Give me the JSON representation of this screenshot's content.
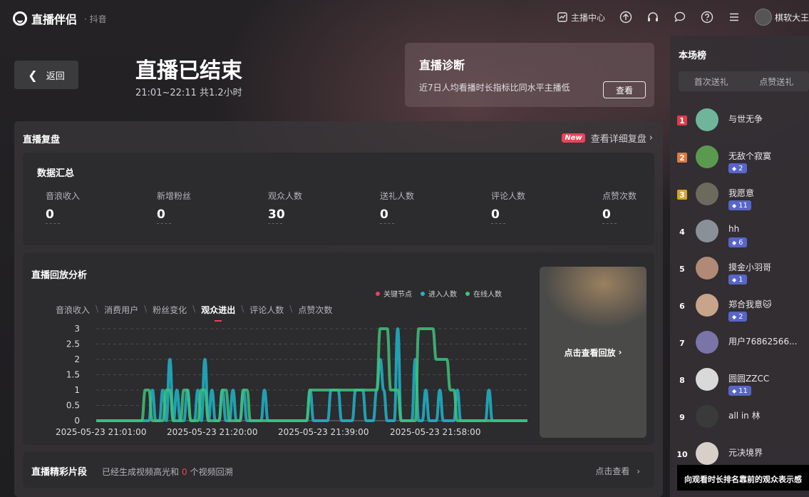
{
  "app": {
    "name": "直播伴侣",
    "platform": "· 抖音"
  },
  "topbar": {
    "anchor_center": "主播中心",
    "user_name": "棋软大王"
  },
  "header": {
    "back_label": "返回",
    "title": "直播已结束",
    "subtitle": "21:01~22:11 共1.2小时",
    "diagnosis": {
      "title": "直播诊断",
      "desc": "近7日人均看播时长指标比同水平主播低",
      "button": "查看"
    }
  },
  "review": {
    "title": "直播复盘",
    "new_badge": "New",
    "detail_link": "查看详细复盘",
    "summary": {
      "title": "数据汇总",
      "metrics": [
        {
          "label": "音浪收入",
          "value": "0"
        },
        {
          "label": "新增粉丝",
          "value": "0"
        },
        {
          "label": "观众人数",
          "value": "30"
        },
        {
          "label": "送礼人数",
          "value": "0"
        },
        {
          "label": "评论人数",
          "value": "0"
        },
        {
          "label": "点赞次数",
          "value": "0"
        }
      ]
    },
    "analysis": {
      "title": "直播回放分析",
      "tabs": [
        "音浪收入",
        "消费用户",
        "粉丝变化",
        "观众进出",
        "评论人数",
        "点赞次数"
      ],
      "active_tab": "观众进出",
      "replay_label": "点击查看回放"
    },
    "highlights": {
      "title": "直播精彩片段",
      "desc_pre": "已经生成视频高光和",
      "count": "0",
      "desc_post": "个视频回溯",
      "link": "点击查看"
    }
  },
  "chart_data": {
    "type": "line",
    "legend": [
      "关键节点",
      "进入人数",
      "在线人数"
    ],
    "colors": {
      "关键节点": "#e8445a",
      "进入人数": "#1fb5c9",
      "在线人数": "#3ec27a"
    },
    "y_ticks": [
      "3",
      "2.5",
      "2",
      "1.5",
      "1",
      "0.5",
      "0"
    ],
    "x_ticks": [
      "2025-05-23 21:01:00",
      "2025-05-23 21:20:00",
      "2025-05-23 21:39:00",
      "2025-05-23 21:58:00"
    ],
    "ylim": [
      0,
      3
    ],
    "series": [
      {
        "name": "进入人数",
        "values": [
          0,
          0,
          0,
          0,
          0,
          0,
          0,
          0,
          0,
          0,
          0,
          0,
          0,
          0,
          0,
          0,
          1,
          0,
          0,
          1,
          0,
          2,
          0,
          1,
          0,
          0,
          1,
          0,
          0,
          1,
          0,
          2,
          0,
          1,
          0,
          0,
          1,
          0,
          0,
          1,
          0,
          0,
          1,
          0,
          0,
          0,
          0,
          0,
          1,
          0,
          0,
          0,
          0,
          0,
          0,
          0,
          0,
          0,
          0,
          0,
          0,
          1,
          0,
          0,
          0,
          0,
          0,
          1,
          1,
          1,
          0,
          0,
          0,
          0,
          1,
          1,
          1,
          0,
          0,
          0,
          1,
          2,
          1,
          0,
          0,
          0,
          3,
          0,
          0,
          0,
          0,
          2,
          0,
          0,
          1,
          0,
          0,
          0,
          1,
          0,
          0,
          0,
          0,
          1,
          0,
          0,
          0,
          0,
          0,
          0,
          0,
          0,
          1,
          0,
          0,
          0,
          0,
          0,
          0,
          0,
          0,
          0,
          0,
          0
        ]
      },
      {
        "name": "在线人数",
        "values": [
          0,
          0,
          0,
          0,
          0,
          0,
          0,
          0,
          0,
          0,
          0,
          0,
          0,
          0,
          1,
          1,
          0,
          0,
          0,
          0,
          1,
          1,
          0,
          0,
          0,
          1,
          1,
          0,
          0,
          0,
          1,
          1,
          0,
          0,
          0,
          0,
          1,
          1,
          0,
          0,
          0,
          0,
          1,
          1,
          0,
          0,
          0,
          0,
          0,
          0,
          0,
          0,
          0,
          0,
          0,
          0,
          0,
          0,
          0,
          0,
          0,
          1,
          1,
          1,
          1,
          1,
          1,
          1,
          1,
          1,
          1,
          1,
          1,
          1,
          1,
          1,
          1,
          1,
          1,
          1,
          1,
          3,
          3,
          3,
          1,
          1,
          1,
          0,
          0,
          0,
          0,
          0,
          3,
          3,
          3,
          3,
          3,
          2,
          2,
          2,
          2,
          1,
          1,
          0,
          0,
          0,
          0,
          0,
          0,
          0,
          0,
          0,
          0,
          0,
          0,
          0,
          0,
          0,
          0,
          0,
          0,
          0,
          0,
          0
        ]
      }
    ]
  },
  "ranking": {
    "title": "本场榜",
    "tabs": [
      "首次送礼",
      "点赞送礼"
    ],
    "items": [
      {
        "rank": "1",
        "name": "与世无争",
        "badge": "",
        "rank_color": "#e03c48",
        "avatar_color": "#6fb59a"
      },
      {
        "rank": "2",
        "name": "无敌个寂寞",
        "badge": "2",
        "rank_color": "#e07a3c",
        "avatar_color": "#5a9a4e"
      },
      {
        "rank": "3",
        "name": "我愿意",
        "badge": "11",
        "rank_color": "#d4a52a",
        "avatar_color": "#6b6a5c"
      },
      {
        "rank": "4",
        "name": "hh",
        "badge": "6",
        "rank_color": "",
        "avatar_color": "#8a9098"
      },
      {
        "rank": "5",
        "name": "摸金小羽哥",
        "badge": "1",
        "rank_color": "",
        "avatar_color": "#b08a74"
      },
      {
        "rank": "6",
        "name": "郑合我意🐱",
        "badge": "2",
        "rank_color": "",
        "avatar_color": "#c7a48a"
      },
      {
        "rank": "7",
        "name": "用户76862566...",
        "badge": "",
        "rank_color": "",
        "avatar_color": "#7a74a8"
      },
      {
        "rank": "8",
        "name": "圆圆ZZCC",
        "badge": "11",
        "rank_color": "",
        "avatar_color": "#d9d9d9"
      },
      {
        "rank": "9",
        "name": "all in 林",
        "badge": "",
        "rank_color": "",
        "avatar_color": "#3a3a3a"
      },
      {
        "rank": "10",
        "name": "元决境界",
        "badge": "",
        "rank_color": "",
        "avatar_color": "#d8d0c8"
      }
    ]
  },
  "tooltip": "向观看时长排名靠前的观众表示感"
}
